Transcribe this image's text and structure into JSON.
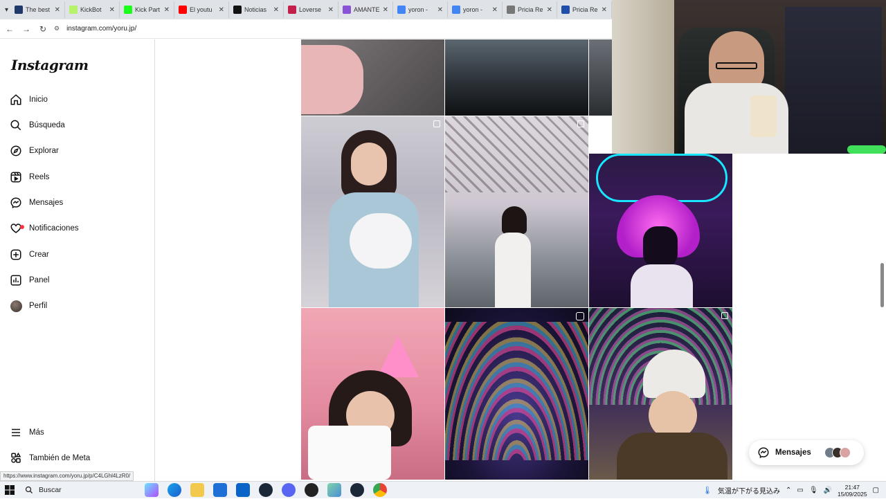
{
  "browser": {
    "tabs": [
      {
        "title": "The best",
        "color": "#1f3a6a"
      },
      {
        "title": "KickBot",
        "color": "#b7f26b"
      },
      {
        "title": "Kick Part",
        "color": "#1aff1a"
      },
      {
        "title": "El youtu",
        "color": "#ff0000"
      },
      {
        "title": "Noticias",
        "color": "#111111"
      },
      {
        "title": "Loverse",
        "color": "#c21f4a"
      },
      {
        "title": "AMANTE",
        "color": "#8a52d6"
      },
      {
        "title": "yoron - ",
        "color": "#4285f4"
      },
      {
        "title": "yoron - ",
        "color": "#4285f4"
      },
      {
        "title": "Pricia Re",
        "color": "#777777"
      },
      {
        "title": "Pricia Re",
        "color": "#1f4fa8"
      }
    ],
    "url": "instagram.com/yoru.jp/",
    "status_url": "https://www.instagram.com/yoru.jp/p/C4LGhl4LzR0/"
  },
  "sidebar": {
    "logo": "Instagram",
    "items": [
      {
        "label": "Inicio",
        "icon": "home-icon"
      },
      {
        "label": "Búsqueda",
        "icon": "search-icon"
      },
      {
        "label": "Explorar",
        "icon": "compass-icon"
      },
      {
        "label": "Reels",
        "icon": "reels-icon"
      },
      {
        "label": "Mensajes",
        "icon": "messenger-icon"
      },
      {
        "label": "Notificaciones",
        "icon": "heart-icon"
      },
      {
        "label": "Crear",
        "icon": "plus-square-icon"
      },
      {
        "label": "Panel",
        "icon": "chart-icon"
      },
      {
        "label": "Perfil",
        "icon": "avatar"
      }
    ],
    "more": "Más",
    "meta": "También de Meta"
  },
  "messages_chip": {
    "label": "Mensajes"
  },
  "taskbar": {
    "search_label": "Buscar",
    "weather": "気温が下がる見込み",
    "time": "21:47",
    "date": "15/09/2025"
  },
  "colors": {
    "accent": "#0095f6",
    "notif": "#ff3040"
  }
}
